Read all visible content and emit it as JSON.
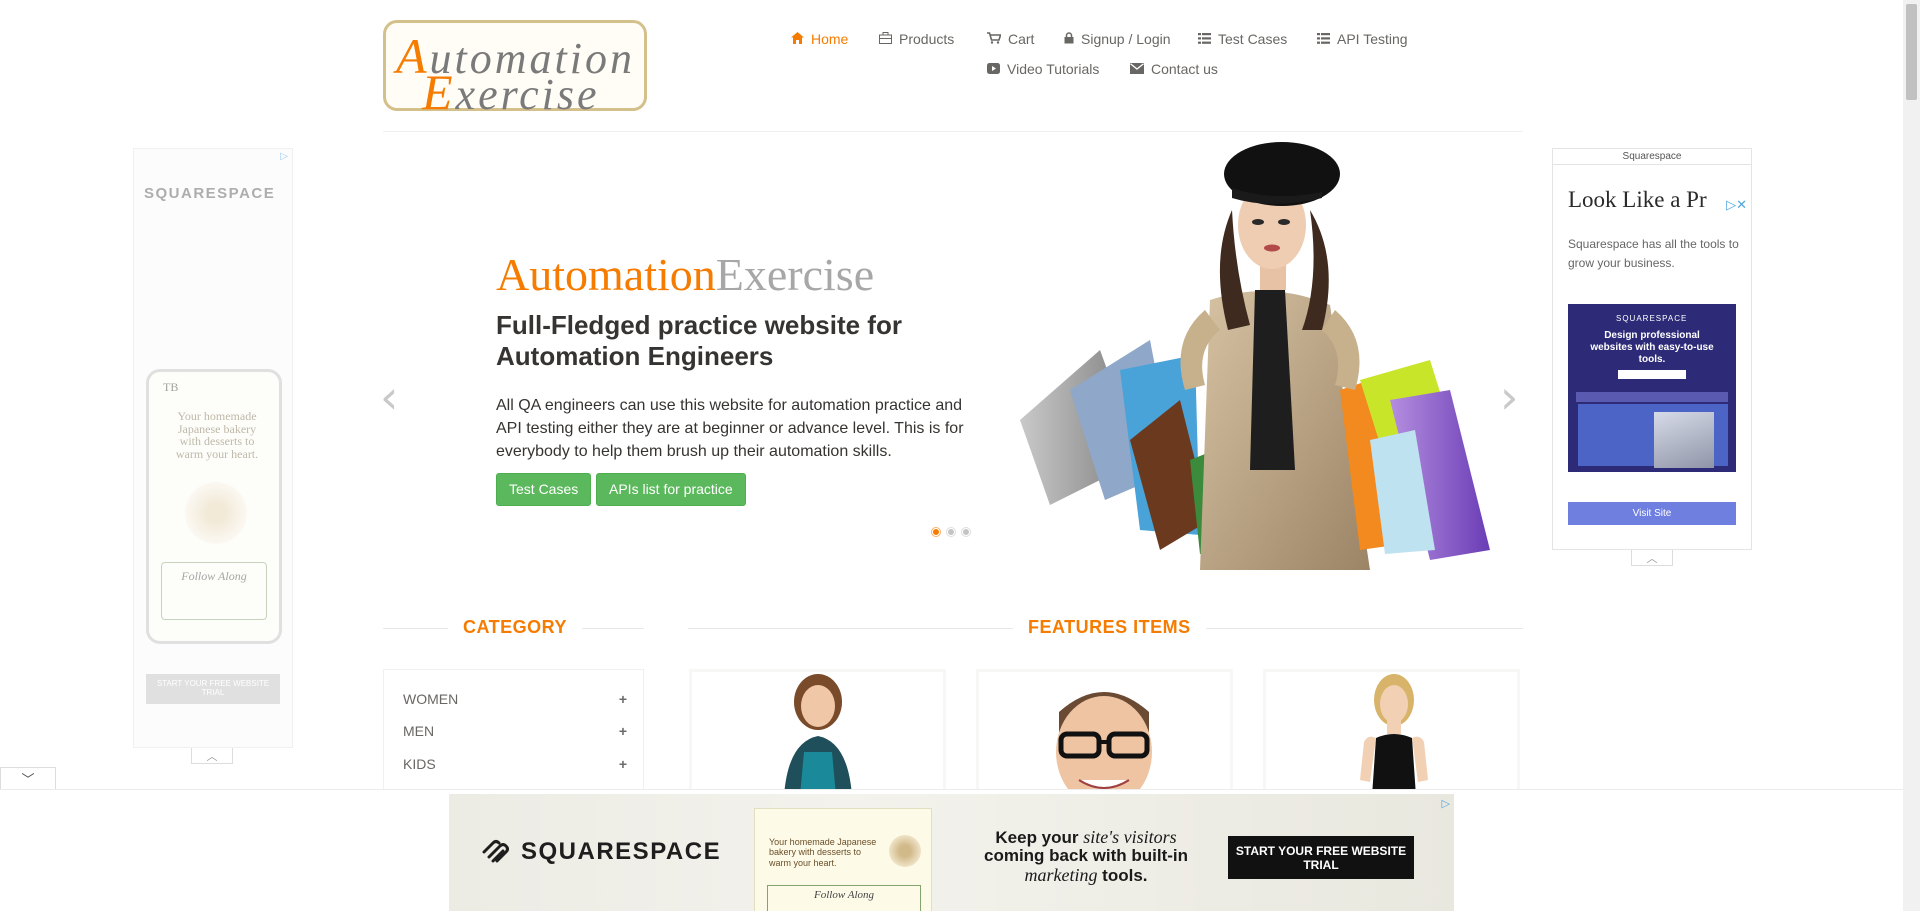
{
  "logo": {
    "line1_cap": "A",
    "line1": "utomation",
    "line2_cap": "E",
    "line2": "xercise"
  },
  "nav": {
    "items": [
      {
        "label": "Home",
        "icon": "home-icon",
        "active": true
      },
      {
        "label": "Products",
        "icon": "briefcase-icon"
      },
      {
        "label": "Cart",
        "icon": "cart-icon"
      },
      {
        "label": "Signup / Login",
        "icon": "lock-icon"
      },
      {
        "label": "Test Cases",
        "icon": "list-icon"
      },
      {
        "label": "API Testing",
        "icon": "list-icon"
      },
      {
        "label": "Video Tutorials",
        "icon": "youtube-icon"
      },
      {
        "label": "Contact us",
        "icon": "envelope-icon"
      }
    ]
  },
  "hero": {
    "brand_orange": "Automation",
    "brand_grey": "Exercise",
    "heading": "Full-Fledged practice website for Automation Engineers",
    "description": "All QA engineers can use this website for automation practice and API testing either they are at beginner or advance level. This is for everybody to help them brush up their automation skills.",
    "btn_test_cases": "Test Cases",
    "btn_apis": "APIs list for practice",
    "prev_arrow": "‹",
    "next_arrow": "›",
    "slides_total": 3,
    "active_slide": 1
  },
  "category": {
    "title": "CATEGORY",
    "items": [
      {
        "label": "WOMEN",
        "toggle": "+"
      },
      {
        "label": "MEN",
        "toggle": "+"
      },
      {
        "label": "KIDS",
        "toggle": "+"
      }
    ]
  },
  "features": {
    "title": "FEATURES ITEMS"
  },
  "ad_left": {
    "brand": "SQUARESPACE",
    "phone_logo": "TB",
    "phone_text": "Your homemade Japanese bakery with desserts to warm your heart.",
    "follow": "Follow Along",
    "cta": "START YOUR FREE WEBSITE TRIAL"
  },
  "ad_right": {
    "header": "Squarespace",
    "headline": "Look Like a Pr",
    "description": "Squarespace has all the tools to grow your business.",
    "shot_brand": "SQUARESPACE",
    "shot_title": "Design professional websites with easy-to-use tools.",
    "visit": "Visit Site"
  },
  "bottom_ad": {
    "brand": "SQUARESPACE",
    "mock_text": "Your homemade Japanese bakery with desserts to warm your heart.",
    "mock_follow": "Follow Along",
    "headline_1": "Keep your ",
    "headline_italic_1": "site's visitors",
    "headline_2": " coming back with built-in ",
    "headline_italic_2": "marketing",
    "headline_3": " tools.",
    "cta": "START YOUR FREE WEBSITE TRIAL"
  },
  "colors": {
    "accent": "#f57c00",
    "button_green": "#5cb85c",
    "text": "#696763"
  }
}
